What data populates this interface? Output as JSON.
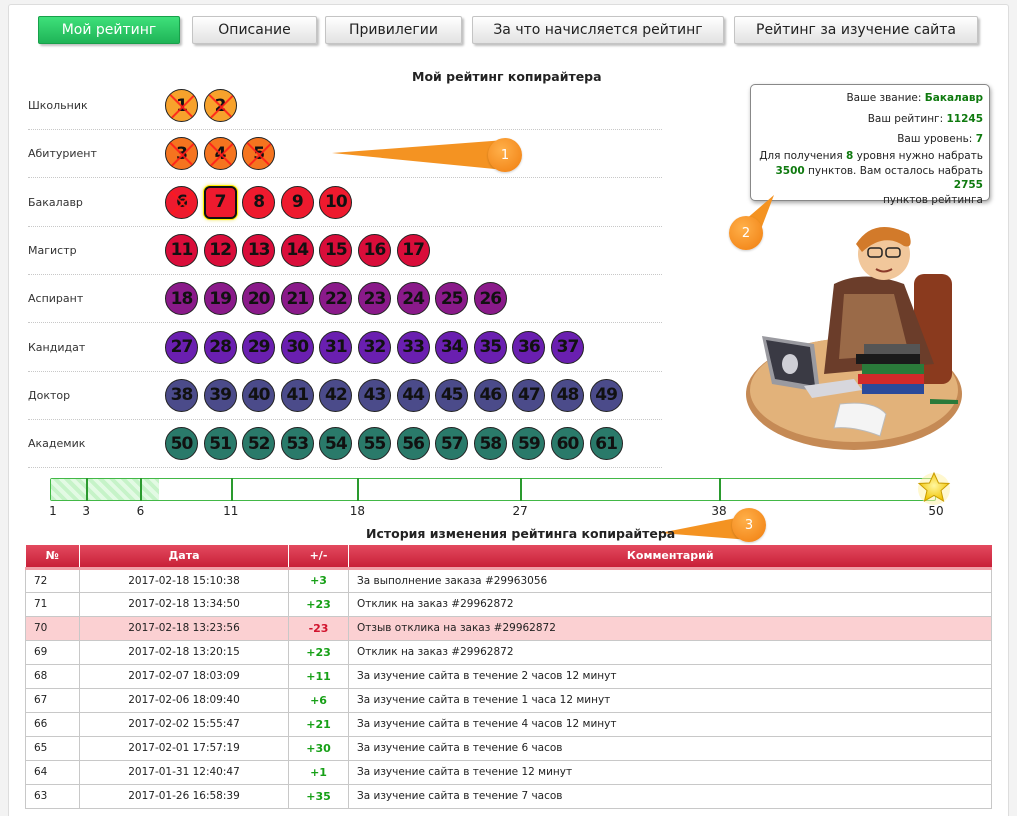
{
  "tabs": [
    {
      "label": "Мой рейтинг",
      "active": true
    },
    {
      "label": "Описание",
      "active": false
    },
    {
      "label": "Привилегии",
      "active": false
    },
    {
      "label": "За что начисляется рейтинг",
      "active": false
    },
    {
      "label": "Рейтинг за изучение сайта",
      "active": false
    }
  ],
  "rating_title": "Мой рейтинг копирайтера",
  "current_level": 7,
  "levels": [
    {
      "name": "Школьник",
      "color": "#f7a22c",
      "numbers": [
        "1",
        "2"
      ]
    },
    {
      "name": "Абитуриент",
      "color": "#f5741f",
      "numbers": [
        "3",
        "4",
        "5"
      ]
    },
    {
      "name": "Бакалавр",
      "color": "#ee1a2e",
      "numbers": [
        "6",
        "7",
        "8",
        "9",
        "10"
      ]
    },
    {
      "name": "Магистр",
      "color": "#d90d3a",
      "numbers": [
        "11",
        "12",
        "13",
        "14",
        "15",
        "16",
        "17"
      ]
    },
    {
      "name": "Аспирант",
      "color": "#8a1a8a",
      "numbers": [
        "18",
        "19",
        "20",
        "21",
        "22",
        "23",
        "24",
        "25",
        "26"
      ]
    },
    {
      "name": "Кандидат",
      "color": "#6a1fb0",
      "numbers": [
        "27",
        "28",
        "29",
        "30",
        "31",
        "32",
        "33",
        "34",
        "35",
        "36",
        "37"
      ]
    },
    {
      "name": "Доктор",
      "color": "#4b4b8a",
      "numbers": [
        "38",
        "39",
        "40",
        "41",
        "42",
        "43",
        "44",
        "45",
        "46",
        "47",
        "48",
        "49"
      ]
    },
    {
      "name": "Академик",
      "color": "#2a7a6a",
      "numbers": [
        "50",
        "51",
        "52",
        "53",
        "54",
        "55",
        "56",
        "57",
        "58",
        "59",
        "60",
        "61"
      ]
    }
  ],
  "info": {
    "rank_label": "Ваше звание:",
    "rank_value": "Бакалавр",
    "rating_label": "Ваш рейтинг:",
    "rating_value": "11245",
    "level_label": "Ваш уровень:",
    "level_value": "7",
    "next_prefix": "Для получения",
    "next_level": "8",
    "next_suffix": "уровня нужно набрать",
    "need_points": "3500",
    "need_middle": "пунктов. Вам осталось набрать",
    "remaining_points": "2755",
    "need_end": "пунктов рейтинга"
  },
  "markers": [
    "1",
    "2",
    "3"
  ],
  "progress": {
    "max": 50,
    "value": 7,
    "ticks": [
      "1",
      "3",
      "6",
      "11",
      "18",
      "27",
      "38",
      "50"
    ]
  },
  "history_title": "История изменения рейтинга копирайтера",
  "history": {
    "headers": [
      "№",
      "Дата",
      "+/-",
      "Комментарий"
    ],
    "rows": [
      {
        "num": "72",
        "date": "2017-02-18 15:10:38",
        "points": "+3",
        "comment": "За выполнение заказа #29963056"
      },
      {
        "num": "71",
        "date": "2017-02-18 13:34:50",
        "points": "+23",
        "comment": "Отклик на заказ #29962872"
      },
      {
        "num": "70",
        "date": "2017-02-18 13:23:56",
        "points": "-23",
        "comment": "Отзыв отклика на заказ #29962872"
      },
      {
        "num": "69",
        "date": "2017-02-18 13:20:15",
        "points": "+23",
        "comment": "Отклик на заказ #29962872"
      },
      {
        "num": "68",
        "date": "2017-02-07 18:03:09",
        "points": "+11",
        "comment": "За изучение сайта в течение 2 часов 12 минут"
      },
      {
        "num": "67",
        "date": "2017-02-06 18:09:40",
        "points": "+6",
        "comment": "За изучение сайта в течение 1 часа 12 минут"
      },
      {
        "num": "66",
        "date": "2017-02-02 15:55:47",
        "points": "+21",
        "comment": "За изучение сайта в течение 4 часов 12 минут"
      },
      {
        "num": "65",
        "date": "2017-02-01 17:57:19",
        "points": "+30",
        "comment": "За изучение сайта в течение 6 часов"
      },
      {
        "num": "64",
        "date": "2017-01-31 12:40:47",
        "points": "+1",
        "comment": "За изучение сайта в течение 12 минут"
      },
      {
        "num": "63",
        "date": "2017-01-26 16:58:39",
        "points": "+35",
        "comment": "За изучение сайта в течение 7 часов"
      }
    ]
  },
  "colors": {
    "accent_green": "#1fb457",
    "table_header": "#c81f38",
    "positive": "#17a017",
    "negative": "#d1142e",
    "marker": "#f07d0e"
  }
}
